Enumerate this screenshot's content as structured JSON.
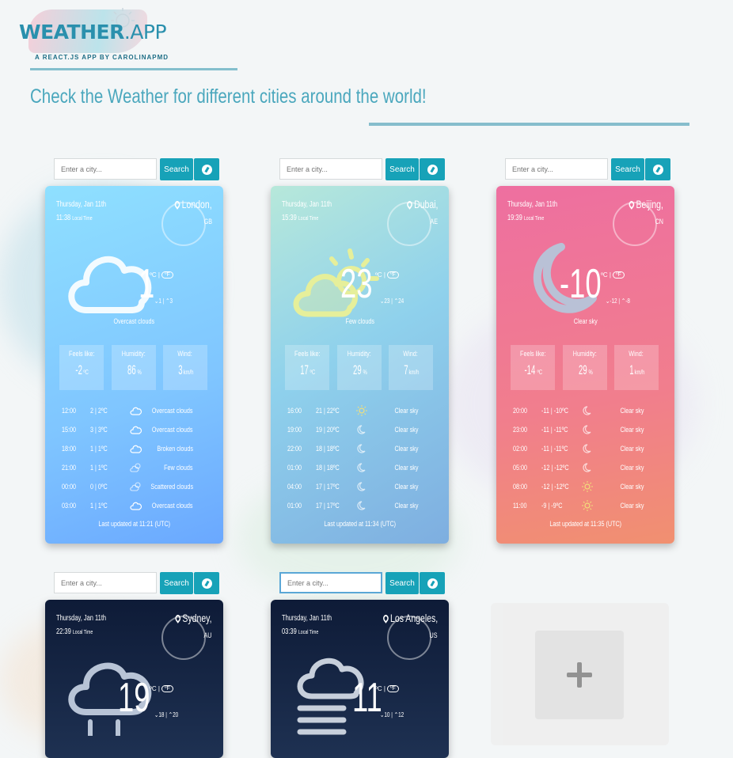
{
  "header": {
    "logo_main": "WEATHER",
    "logo_app": ".APP",
    "logo_sub": "A REACT.JS APP BY CAROLINAPMD",
    "headline": "Check the Weather for different cities around the world!"
  },
  "search": {
    "placeholder": "Enter a city...",
    "button_label": "Search"
  },
  "labels": {
    "feels_like": "Feels like:",
    "humidity": "Humidity:",
    "wind": "Wind:",
    "units_c": "ºC |",
    "units_f": "ºF"
  },
  "cards": [
    {
      "date": "Thursday, Jan 11th",
      "time": "11:38",
      "local": "Local Time",
      "city": "London,",
      "country": "GB",
      "temp": "1",
      "min": "1",
      "max": "3",
      "description": "Overcast clouds",
      "feels": "-2",
      "feels_unit": "ºC",
      "humidity": "86",
      "wind": "3",
      "wind_unit": "km/h",
      "forecast": [
        {
          "time": "12:00",
          "temps": "2 | 2ºC",
          "icon": "cloud-icon",
          "desc": "Overcast clouds"
        },
        {
          "time": "15:00",
          "temps": "3 | 3ºC",
          "icon": "cloud-icon",
          "desc": "Overcast clouds"
        },
        {
          "time": "18:00",
          "temps": "1 | 1ºC",
          "icon": "cloud-icon",
          "desc": "Broken clouds"
        },
        {
          "time": "21:00",
          "temps": "1 | 1ºC",
          "icon": "few-clouds-icon",
          "desc": "Few clouds"
        },
        {
          "time": "00:00",
          "temps": "0 | 0ºC",
          "icon": "few-clouds-icon",
          "desc": "Scattered clouds"
        },
        {
          "time": "03:00",
          "temps": "1 | 1ºC",
          "icon": "cloud-icon",
          "desc": "Overcast clouds"
        }
      ],
      "updated": "Last updated at 11:21 (UTC)"
    },
    {
      "date": "Thursday, Jan 11th",
      "time": "15:39",
      "local": "Local Time",
      "city": "Dubai,",
      "country": "AE",
      "temp": "23",
      "min": "23",
      "max": "24",
      "description": "Few clouds",
      "feels": "17",
      "feels_unit": "ºC",
      "humidity": "29",
      "wind": "7",
      "wind_unit": "km/h",
      "forecast": [
        {
          "time": "16:00",
          "temps": "21 | 22ºC",
          "icon": "sun-icon",
          "desc": "Clear sky"
        },
        {
          "time": "19:00",
          "temps": "19 | 20ºC",
          "icon": "moon-icon",
          "desc": "Clear sky"
        },
        {
          "time": "22:00",
          "temps": "18 | 18ºC",
          "icon": "moon-icon",
          "desc": "Clear sky"
        },
        {
          "time": "01:00",
          "temps": "18 | 18ºC",
          "icon": "moon-icon",
          "desc": "Clear sky"
        },
        {
          "time": "04:00",
          "temps": "17 | 17ºC",
          "icon": "moon-icon",
          "desc": "Clear sky"
        },
        {
          "time": "01:00",
          "temps": "17 | 17ºC",
          "icon": "moon-icon",
          "desc": "Clear sky"
        }
      ],
      "updated": "Last updated at 11:34 (UTC)"
    },
    {
      "date": "Thursday, Jan 11th",
      "time": "19:39",
      "local": "Local Time",
      "city": "Beijing,",
      "country": "CN",
      "temp": "-10",
      "min": "-12",
      "max": "-8",
      "description": "Clear sky",
      "feels": "-14",
      "feels_unit": "ºC",
      "humidity": "29",
      "wind": "1",
      "wind_unit": "km/h",
      "forecast": [
        {
          "time": "20:00",
          "temps": "-11 | -10ºC",
          "icon": "moon-icon",
          "desc": "Clear sky"
        },
        {
          "time": "23:00",
          "temps": "-11 | -11ºC",
          "icon": "moon-icon",
          "desc": "Clear sky"
        },
        {
          "time": "02:00",
          "temps": "-11 | -11ºC",
          "icon": "moon-icon",
          "desc": "Clear sky"
        },
        {
          "time": "05:00",
          "temps": "-12 | -12ºC",
          "icon": "moon-icon",
          "desc": "Clear sky"
        },
        {
          "time": "08:00",
          "temps": "-12 | -12ºC",
          "icon": "sun-icon",
          "desc": "Clear sky"
        },
        {
          "time": "11:00",
          "temps": "-9 | -9ºC",
          "icon": "sun-icon",
          "desc": "Clear sky"
        }
      ],
      "updated": "Last updated at 11:35 (UTC)"
    },
    {
      "date": "Thursday, Jan 11th",
      "time": "22:39",
      "local": "Local Time",
      "city": "Sydney,",
      "country": "AU",
      "temp": "19",
      "min": "18",
      "max": "20"
    },
    {
      "date": "Thursday, Jan 11th",
      "time": "03:39",
      "local": "Local Time",
      "city": "Los Angeles,",
      "country": "US",
      "temp": "11",
      "min": "10",
      "max": "12"
    }
  ]
}
